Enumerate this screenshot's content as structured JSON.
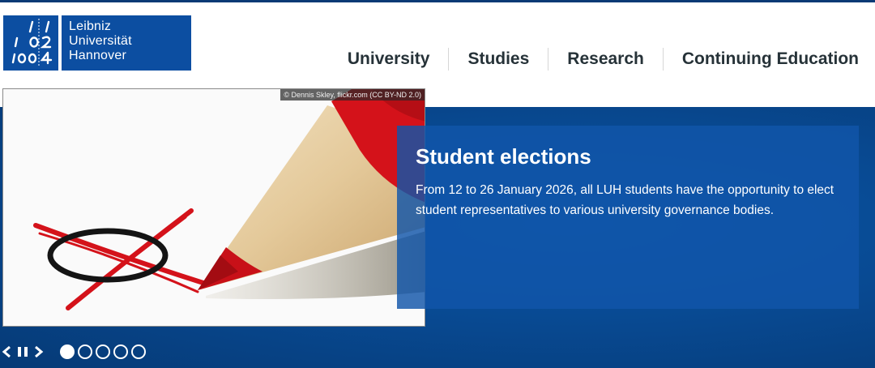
{
  "logo": {
    "mark_rows": [
      "/ /",
      "ı 0 2",
      "1 0 0 4"
    ],
    "lines": [
      "Leibniz",
      "Universität",
      "Hannover"
    ]
  },
  "nav": {
    "items": [
      "University",
      "Studies",
      "Research",
      "Continuing Education"
    ]
  },
  "slide": {
    "credit": "© Dennis Skley, flickr.com (CC BY-ND 2.0)",
    "title": "Student elections",
    "text": "From 12 to 26 January 2026, all LUH students have the opportunity to elect student representatives to various university governance bodies."
  },
  "slider": {
    "slide_count": 5,
    "active_index": 0
  },
  "colors": {
    "brand_blue": "#0c4ea1",
    "hero_blue": "#084a93",
    "nav_text": "#263238",
    "pencil_red": "#d4121a"
  }
}
